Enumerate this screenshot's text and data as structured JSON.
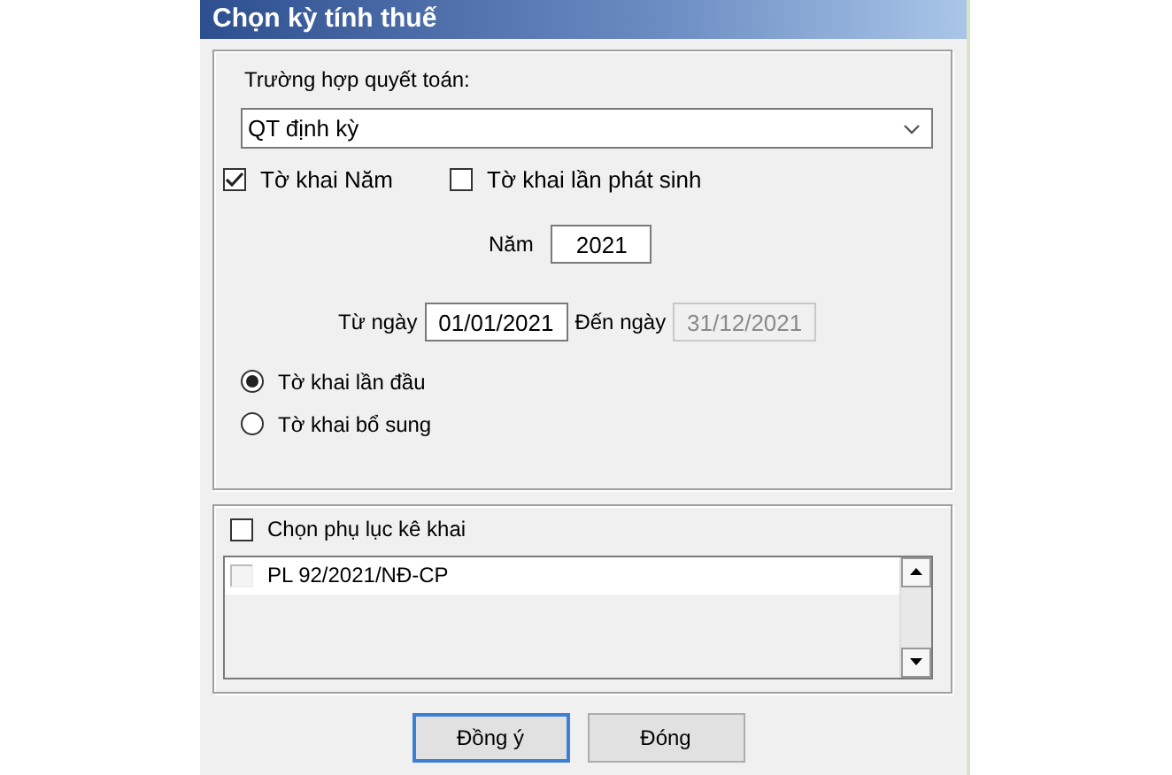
{
  "window": {
    "title": "Chọn kỳ tính thuế"
  },
  "settlement": {
    "label": "Trường hợp quyết toán:",
    "value": "QT định kỳ"
  },
  "declaration_types": [
    {
      "label": "Tờ khai Năm",
      "checked": true
    },
    {
      "label": "Tờ khai lần phát sinh",
      "checked": false
    }
  ],
  "year": {
    "label": "Năm",
    "value": "2021"
  },
  "from_date": {
    "label": "Từ ngày",
    "value": "01/01/2021",
    "disabled": false
  },
  "to_date": {
    "label": "Đến ngày",
    "value": "31/12/2021",
    "disabled": true
  },
  "submission": [
    {
      "label": "Tờ khai lần đầu",
      "selected": true
    },
    {
      "label": "Tờ khai bổ sung",
      "selected": false
    }
  ],
  "appendix": {
    "label": "Chọn phụ lục kê khai",
    "checked": false,
    "items": [
      {
        "label": "PL 92/2021/NĐ-CP",
        "checked": false
      }
    ]
  },
  "buttons": [
    {
      "label": "Đồng ý",
      "default": true
    },
    {
      "label": "Đóng",
      "default": false
    }
  ]
}
